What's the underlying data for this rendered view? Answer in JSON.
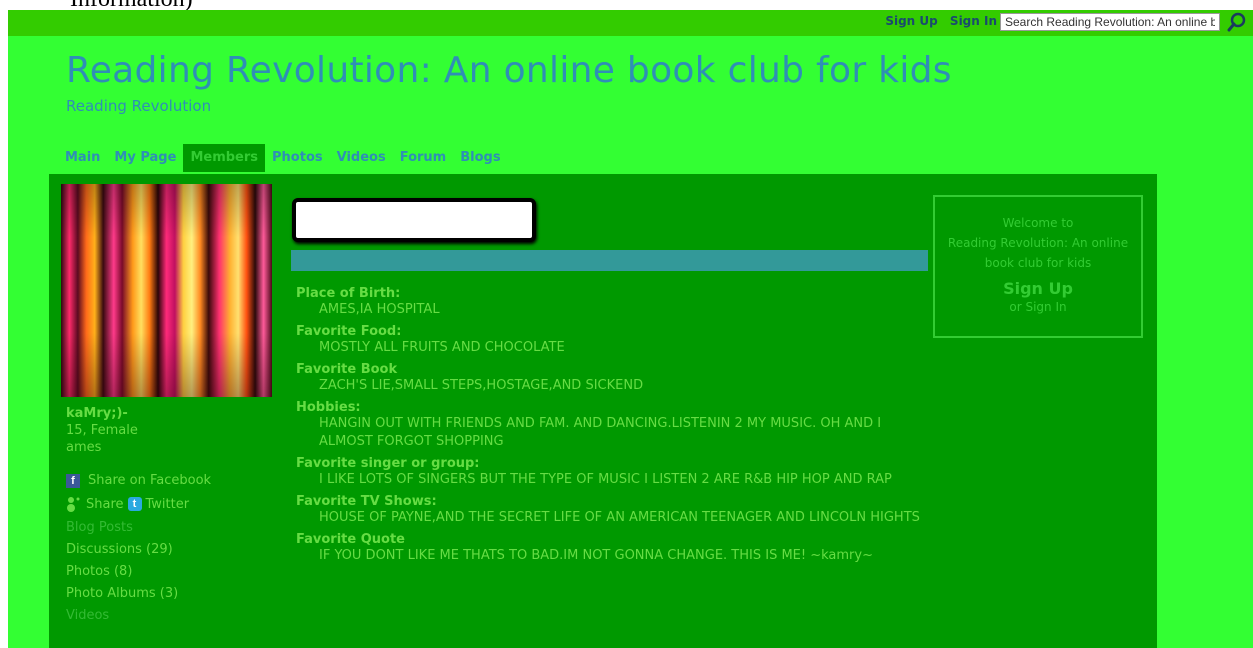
{
  "top_fragment": "Information)",
  "topbar": {
    "sign_up": "Sign Up",
    "sign_in": "Sign In",
    "search_placeholder": "Search Reading Revolution: An online book club for kids",
    "search_icon": "search-icon"
  },
  "header": {
    "title": "Reading Revolution: An online book club for kids",
    "subtitle": "Reading Revolution"
  },
  "nav": {
    "tabs": [
      {
        "label": "Main"
      },
      {
        "label": "My Page"
      },
      {
        "label": "Members"
      },
      {
        "label": "Photos"
      },
      {
        "label": "Videos"
      },
      {
        "label": "Forum"
      },
      {
        "label": "Blogs"
      }
    ],
    "active": "Members"
  },
  "profile": {
    "name": "kaMry;)-",
    "age_gender": "15, Female",
    "location": "ames"
  },
  "share": {
    "facebook": "Share on Facebook",
    "share": "Share",
    "twitter": "Twitter"
  },
  "side_links": [
    {
      "label": "Blog Posts"
    },
    {
      "label": "Discussions (29)"
    },
    {
      "label": "Photos (8)"
    },
    {
      "label": "Photo Albums (3)"
    },
    {
      "label": "Videos"
    }
  ],
  "fields": [
    {
      "label": "Place of Birth:",
      "value": "AMES,IA HOSPITAL"
    },
    {
      "label": "Favorite Food:",
      "value": "MOSTLY ALL FRUITS AND CHOCOLATE"
    },
    {
      "label": "Favorite Book",
      "value": "ZACH'S LIE,SMALL STEPS,HOSTAGE,AND SICKEND"
    },
    {
      "label": "Hobbies:",
      "value": "HANGIN OUT WITH FRIENDS AND FAM. AND DANCING.LISTENIN 2 MY MUSIC. OH AND I ALMOST FORGOT SHOPPING"
    },
    {
      "label": "Favorite singer or group:",
      "value": "I LIKE LOTS OF SINGERS BUT THE TYPE OF MUSIC I LISTEN 2 ARE R&B HIP HOP AND RAP"
    },
    {
      "label": "Favorite TV Shows:",
      "value": "HOUSE OF PAYNE,AND THE SECRET LIFE OF AN AMERICAN TEENAGER AND LINCOLN HIGHTS"
    },
    {
      "label": "Favorite Quote",
      "value": "IF YOU DONT LIKE ME THATS TO BAD.IM NOT GONNA CHANGE. THIS IS ME! ~kamry~"
    }
  ],
  "welcome": {
    "line1": "Welcome to",
    "line2": "Reading Revolution: An online book club for kids",
    "sign_up": "Sign Up",
    "sign_in": "or Sign In"
  },
  "colors": {
    "page_bg": "#33ff33",
    "topbar": "#33cc00",
    "content_bg": "#009900",
    "title": "#2f8fb6",
    "text": "#66dd44"
  }
}
